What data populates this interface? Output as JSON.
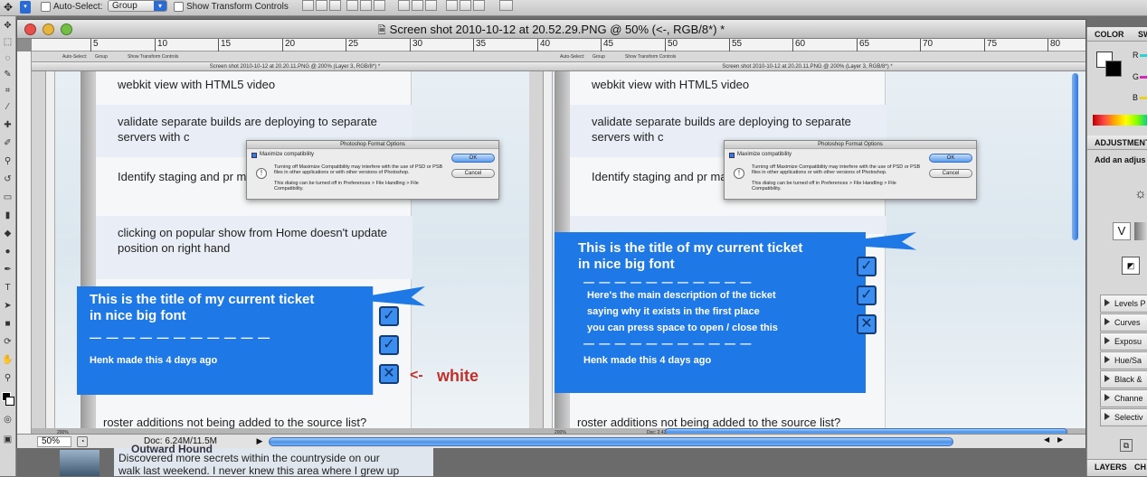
{
  "options_bar": {
    "auto_select_label": "Auto-Select:",
    "group_value": "Group",
    "show_transform_label": "Show Transform Controls"
  },
  "window": {
    "title": "Screen shot 2010-10-12 at 20.52.29.PNG @ 50% (<-, RGB/8*) *"
  },
  "ruler_numbers": [
    "5",
    "10",
    "15",
    "20",
    "25",
    "30",
    "35",
    "40",
    "45",
    "50",
    "55",
    "60",
    "65",
    "70",
    "75",
    "80"
  ],
  "status": {
    "zoom": "50%",
    "doc": "Doc: 6.24M/11.5M"
  },
  "inner": {
    "title": "Screen shot 2010-10-12 at 20.20.11.PNG @ 200% (Layer 3, RGB/8*) *",
    "opt_auto_select": "Auto-Select:",
    "opt_group": "Group",
    "opt_show_transform": "Show Transform Controls",
    "zoom": "200%",
    "doc": "Doc: 2.43M/8.63M"
  },
  "list_items": [
    "webkit view with HTML5 video",
    "validate separate builds are deploying to separate servers with c",
    "Identify staging and pr mac client",
    "clicking on popular show from Home doesn't update position on right hand",
    "roster additions not being added to the source list?"
  ],
  "list_items_right": [
    "webkit view with HTML5 video",
    "validate separate builds are deploying to separate servers with c",
    "Identify staging and pr mac client",
    "roster additions not being added to the source list?"
  ],
  "dialog": {
    "title": "Photoshop Format Options",
    "checkbox_label": "Maximize compatibility",
    "text": "Turning off Maximize Compatibility may interfere with the use of PSD or PSB files in other applications or with other versions of Photoshop.",
    "text2": "This dialog can be turned off in Preferences > File Handling > File Compatibility.",
    "ok": "OK",
    "cancel": "Cancel"
  },
  "ticket_left": {
    "title": "This is the title of my current ticket in nice big font",
    "dashes": "— — — — — — — — — — —",
    "meta": "Henk made this 4 days ago"
  },
  "ticket_right": {
    "title": "This is the title of my current ticket in nice big font",
    "dashes1": "— — — — — — — — — — —",
    "desc1": "Here's the main description of the ticket",
    "desc2": "saying why it exists in the first place",
    "desc3": "you can press space to open / close this",
    "dashes2": "— — — — — — — — — — —",
    "meta": "Henk made this 4 days ago"
  },
  "annotation": {
    "text": "white",
    "arrow": "<-"
  },
  "color_panel": {
    "tab": "COLOR",
    "tab2": "SW",
    "r": "R",
    "g": "G",
    "b": "B"
  },
  "adjustments_panel": {
    "title": "ADJUSTMENT",
    "subtitle": "Add an adjus",
    "items": [
      "Levels P",
      "Curves",
      "Exposu",
      "Hue/Sa",
      "Black &",
      "Channe",
      "Selectiv"
    ]
  },
  "layers_panel": {
    "tab": "LAYERS",
    "tab2": "CH"
  },
  "bottom_text": {
    "title": "Outward Hound",
    "line1": "Discovered more secrets within the countryside on our",
    "line2": "walk last weekend. I never knew this area where I grew up"
  },
  "colors": {
    "ticket_blue": "#1e78e6",
    "annotation_red": "#c0302a",
    "scroll_blue": "#4d92e7"
  }
}
